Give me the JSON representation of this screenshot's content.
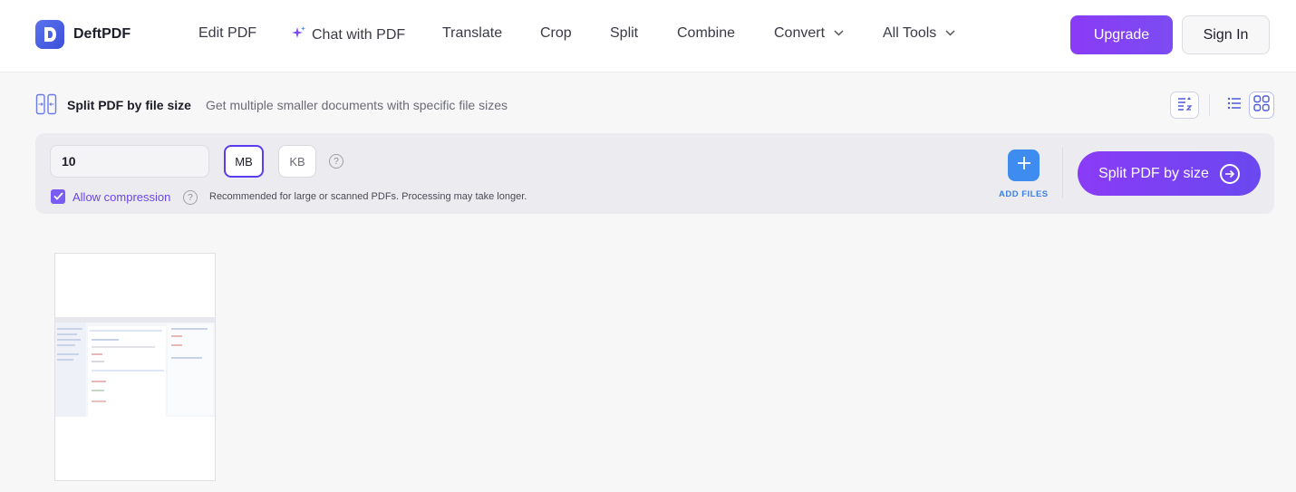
{
  "header": {
    "brand": "DeftPDF",
    "nav": [
      {
        "label": "Edit PDF"
      },
      {
        "label": "Chat with PDF"
      },
      {
        "label": "Translate"
      },
      {
        "label": "Crop"
      },
      {
        "label": "Split"
      },
      {
        "label": "Combine"
      },
      {
        "label": "Convert"
      },
      {
        "label": "All Tools"
      }
    ],
    "upgrade_label": "Upgrade",
    "signin_label": "Sign In"
  },
  "tool": {
    "title": "Split PDF by file size",
    "description": "Get multiple smaller documents with specific file sizes"
  },
  "options": {
    "size_value": "10",
    "units": [
      "MB",
      "KB"
    ],
    "selected_unit": "MB",
    "allow_compression_label": "Allow compression",
    "allow_compression_checked": true,
    "compression_note": "Recommended for large or scanned PDFs. Processing may take longer.",
    "add_files_label": "ADD FILES",
    "split_button_label": "Split PDF by size"
  },
  "colors": {
    "accent": "#7b4cf2",
    "add_blue": "#3f8cf0"
  }
}
